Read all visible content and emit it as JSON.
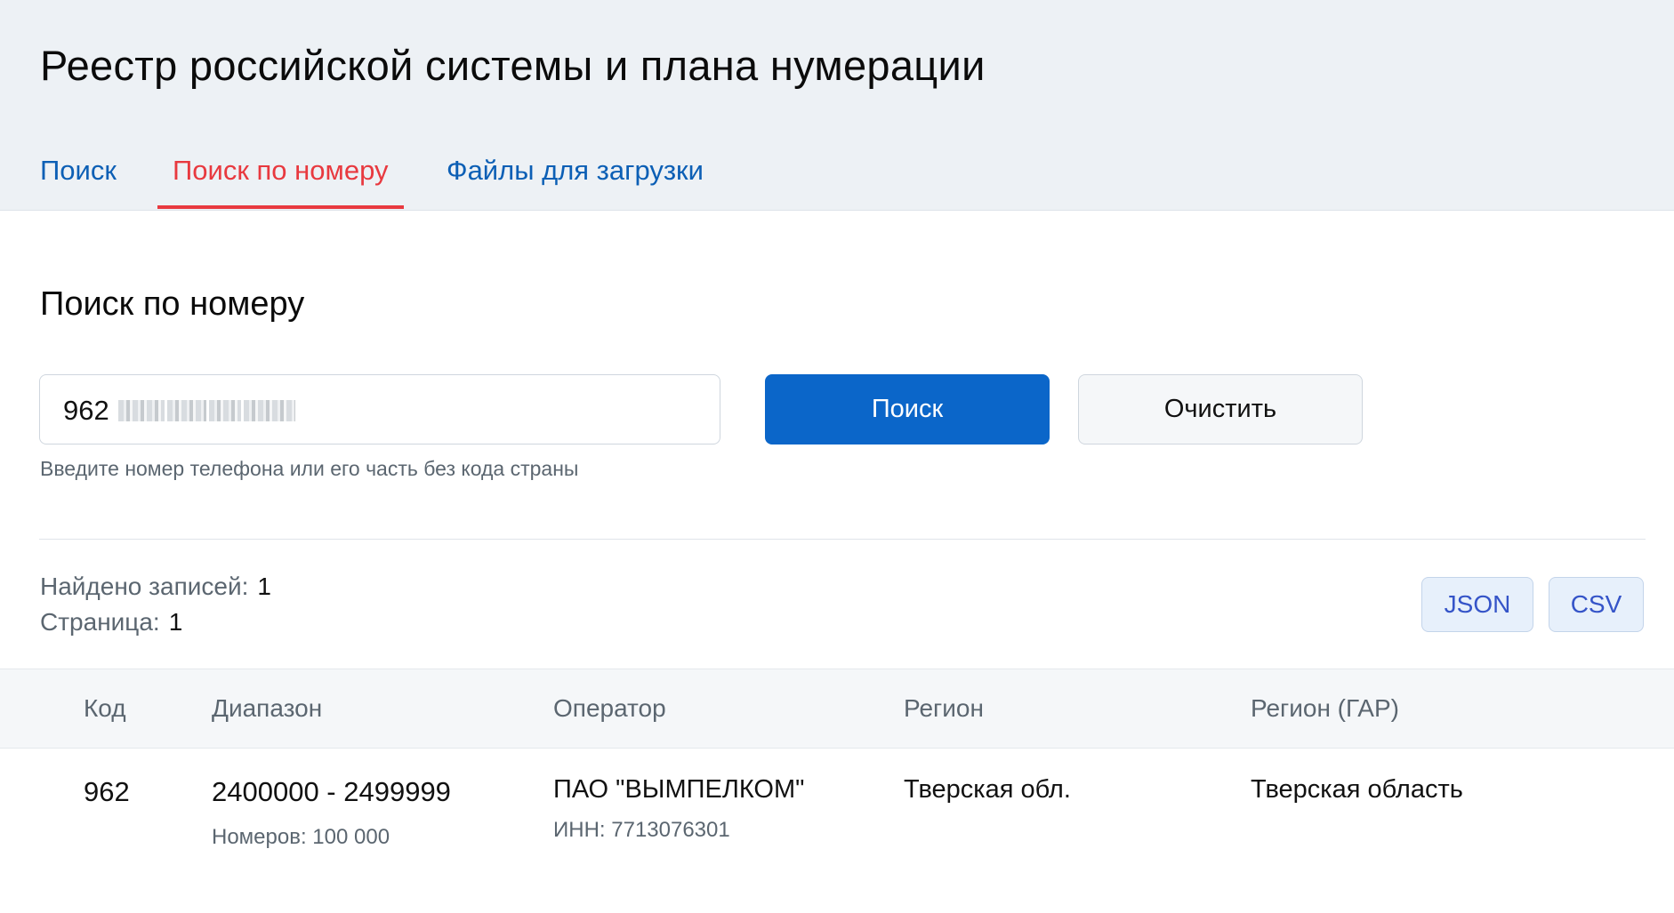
{
  "header": {
    "title": "Реестр российской системы и плана нумерации",
    "tabs": [
      {
        "label": "Поиск",
        "active": false
      },
      {
        "label": "Поиск по номеру",
        "active": true
      },
      {
        "label": "Файлы для загрузки",
        "active": false
      }
    ]
  },
  "search": {
    "section_title": "Поиск по номеру",
    "input_value_visible": "962",
    "input_value_redacted": true,
    "hint": "Введите номер телефона или его часть без кода страны",
    "search_label": "Поиск",
    "clear_label": "Очистить"
  },
  "results": {
    "found_label": "Найдено записей:",
    "found_value": "1",
    "page_label": "Страница:",
    "page_value": "1",
    "export": [
      "JSON",
      "CSV"
    ]
  },
  "table": {
    "columns": [
      "Код",
      "Диапазон",
      "Оператор",
      "Регион",
      "Регион (ГАР)"
    ],
    "rows": [
      {
        "code": "962",
        "range": "2400000 - 2499999",
        "count": "Номеров: 100 000",
        "operator": "ПАО \"ВЫМПЕЛКОМ\"",
        "inn": "ИНН: 7713076301",
        "region": "Тверская обл.",
        "region_gar": "Тверская область"
      }
    ]
  },
  "colors": {
    "header_bg": "#edf1f5",
    "tab_link": "#0c5fb5",
    "tab_active": "#e8393f",
    "primary_button": "#0b66c9",
    "export_text": "#3554c8"
  }
}
